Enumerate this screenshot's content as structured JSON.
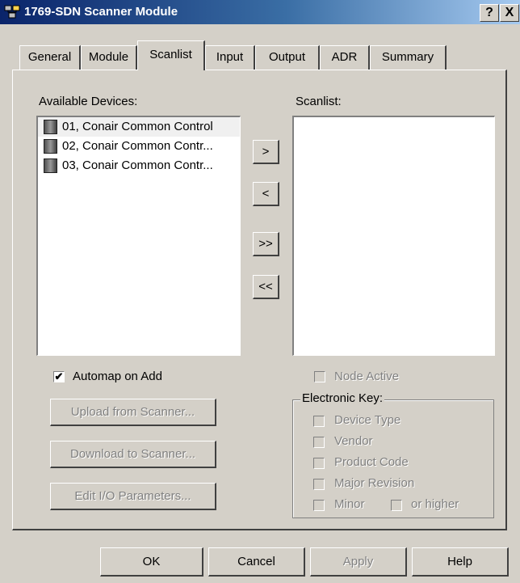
{
  "window": {
    "title": "1769-SDN Scanner Module",
    "help_button": "?",
    "close_button": "X",
    "icon": "network-app-icon"
  },
  "tabs": [
    {
      "label": "General"
    },
    {
      "label": "Module"
    },
    {
      "label": "Scanlist",
      "active": true
    },
    {
      "label": "Input"
    },
    {
      "label": "Output"
    },
    {
      "label": "ADR"
    },
    {
      "label": "Summary"
    }
  ],
  "available": {
    "label": "Available Devices:",
    "items": [
      {
        "text": "01, Conair Common Control",
        "icon": "device-icon"
      },
      {
        "text": "02, Conair Common Contr...",
        "icon": "device-icon"
      },
      {
        "text": "03, Conair Common Contr...",
        "icon": "device-icon"
      }
    ]
  },
  "scanlist": {
    "label": "Scanlist:"
  },
  "transfer_buttons": {
    "add": ">",
    "remove": "<",
    "add_all": ">>",
    "remove_all": "<<"
  },
  "automap": {
    "label": "Automap on Add",
    "checked": true
  },
  "actions": {
    "upload": "Upload from Scanner...",
    "download": "Download to Scanner...",
    "edit_io": "Edit I/O Parameters..."
  },
  "node_active": {
    "label": "Node Active",
    "checked": false
  },
  "electronic_key": {
    "label": "Electronic Key:",
    "device_type": "Device Type",
    "vendor": "Vendor",
    "product_code": "Product Code",
    "major_revision": "Major Revision",
    "minor": "Minor",
    "or_higher": "or higher"
  },
  "footer": {
    "ok": "OK",
    "cancel": "Cancel",
    "apply": "Apply",
    "help": "Help"
  }
}
